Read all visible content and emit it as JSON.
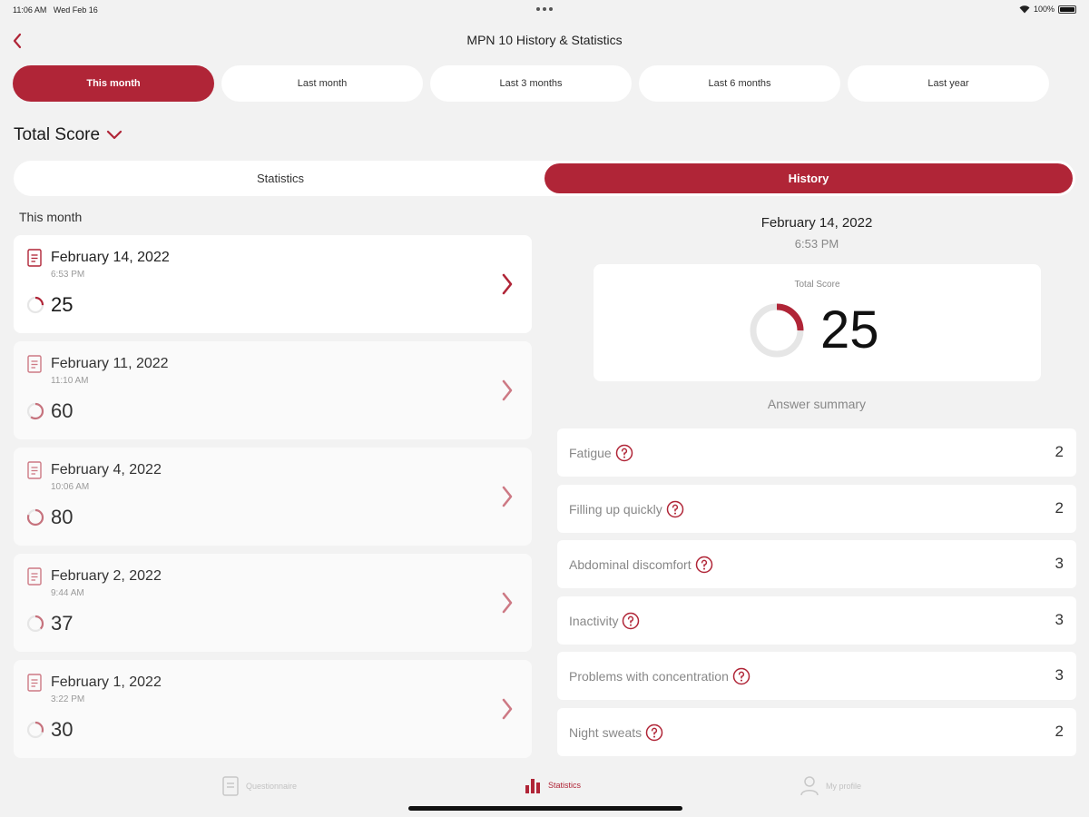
{
  "status_bar": {
    "time": "11:06 AM",
    "date": "Wed Feb 16",
    "battery": "100%"
  },
  "header": {
    "title": "MPN 10 History & Statistics"
  },
  "periods": [
    {
      "label": "This month",
      "active": true
    },
    {
      "label": "Last month",
      "active": false
    },
    {
      "label": "Last 3 months",
      "active": false
    },
    {
      "label": "Last 6 months",
      "active": false
    },
    {
      "label": "Last year",
      "active": false
    }
  ],
  "score_selector": {
    "label": "Total Score"
  },
  "segments": {
    "statistics": "Statistics",
    "history": "History",
    "active": "history"
  },
  "history": {
    "section_label": "This month",
    "entries": [
      {
        "date": "February 14, 2022",
        "time": "6:53 PM",
        "score": "25",
        "selected": true
      },
      {
        "date": "February 11, 2022",
        "time": "11:10 AM",
        "score": "60",
        "selected": false
      },
      {
        "date": "February 4, 2022",
        "time": "10:06 AM",
        "score": "80",
        "selected": false
      },
      {
        "date": "February 2, 2022",
        "time": "9:44 AM",
        "score": "37",
        "selected": false
      },
      {
        "date": "February 1, 2022",
        "time": "3:22 PM",
        "score": "30",
        "selected": false
      }
    ]
  },
  "detail": {
    "date": "February 14, 2022",
    "time": "6:53 PM",
    "score_label": "Total Score",
    "score": "25",
    "summary_label": "Answer summary",
    "answers": [
      {
        "label": "Fatigue",
        "value": "2"
      },
      {
        "label": "Filling up quickly",
        "value": "2"
      },
      {
        "label": "Abdominal discomfort",
        "value": "3"
      },
      {
        "label": "Inactivity",
        "value": "3"
      },
      {
        "label": "Problems with concentration",
        "value": "3"
      },
      {
        "label": "Night sweats",
        "value": "2"
      }
    ]
  },
  "tabbar": {
    "tabs": [
      {
        "label": "Questionnaire",
        "icon": "document-icon",
        "active": false
      },
      {
        "label": "Statistics",
        "icon": "bar-chart-icon",
        "active": true
      },
      {
        "label": "My profile",
        "icon": "person-icon",
        "active": false
      }
    ]
  },
  "colors": {
    "accent": "#b02537",
    "background": "#f2f2f2",
    "card": "#ffffff",
    "muted_ring": "#e6e6e6"
  }
}
